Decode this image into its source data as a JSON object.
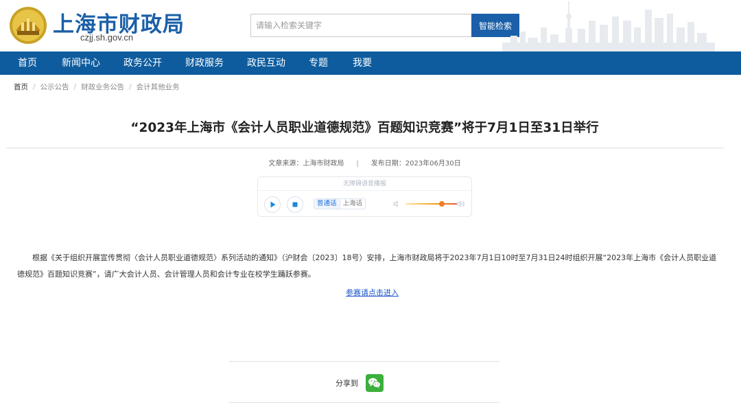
{
  "header": {
    "site_title": "上海市财政局",
    "domain": "czjj.sh.gov.cn",
    "search_placeholder": "请输入检索关键字",
    "search_button": "智能检索"
  },
  "nav": {
    "items": [
      "首页",
      "新闻中心",
      "政务公开",
      "财政服务",
      "政民互动",
      "专题",
      "我要"
    ]
  },
  "breadcrumb": [
    "首页",
    "公示公告",
    "财政业务公告",
    "会计其他业务"
  ],
  "article": {
    "title": "“2023年上海市《会计人员职业道德规范》百题知识竞赛”将于7月1日至31日举行",
    "source": "文章来源：上海市财政局",
    "meta_divider": "|",
    "date": "发布日期：2023年06月30日",
    "body": "根据《关于组织开展宣传贯彻〈会计人员职业道德规范〉系列活动的通知》（沪财会〔2023〕18号）安排，上海市财政局将于2023年7月1日10时至7月31日24时组织开展“2023年上海市《会计人员职业道德规范》百题知识竞赛”，请广大会计人员、会计管理人员和会计专业在校学生踊跃参赛。",
    "link": "参赛请点击进入"
  },
  "player": {
    "header": "无障碍语音播报",
    "lang_active": "普通话",
    "lang_other": "上海话",
    "volume": 0.7
  },
  "share": {
    "label": "分享到",
    "icon": "wechat-icon"
  }
}
